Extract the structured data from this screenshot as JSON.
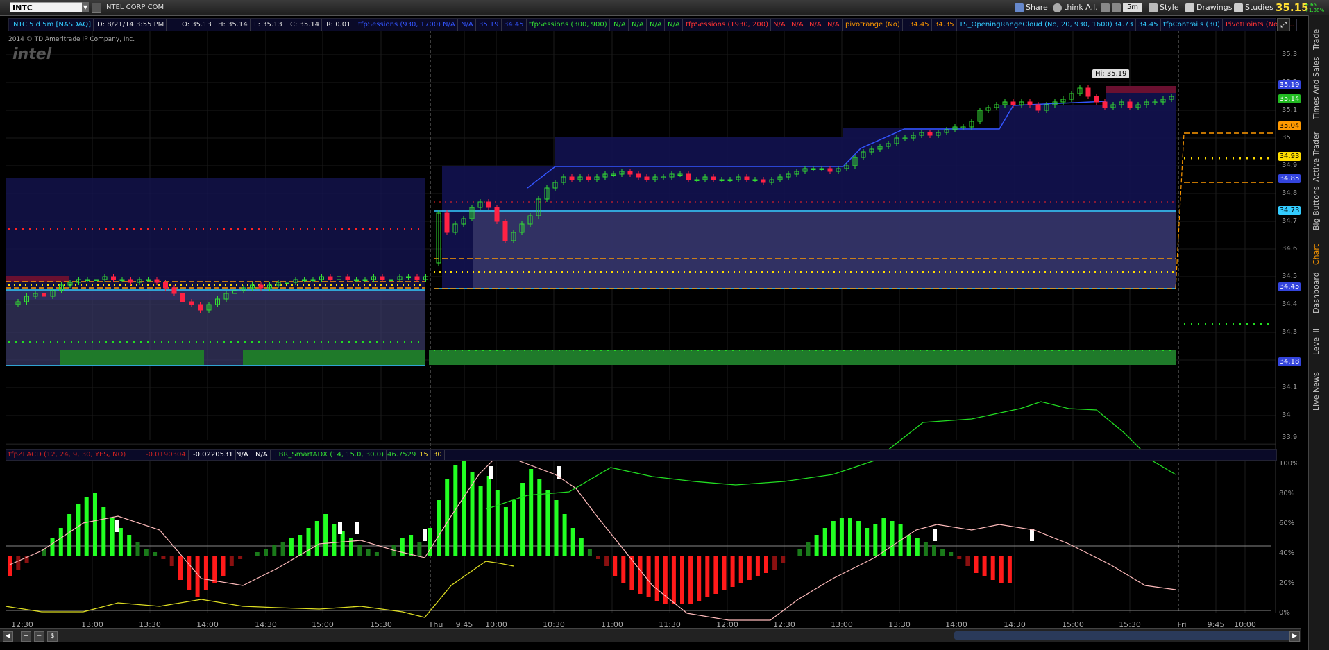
{
  "toolbar": {
    "symbol": "INTC",
    "company": "INTEL CORP COM",
    "share": "Share",
    "think": "think A.I.",
    "timeframe": "5m",
    "style": "Style",
    "drawings": "Drawings",
    "studies": "Studies",
    "last_price": "35.15",
    "change_line1": "+.65",
    "change_line2": "+1.88%"
  },
  "studybar": {
    "items": [
      {
        "text": "INTC 5 d 5m [NASDAQ]",
        "color": "#33ccff"
      },
      {
        "text": "D: 8/21/14 3:55 PM",
        "color": "#dddddd"
      },
      {
        "text": "O: 35.13",
        "color": "#dddddd"
      },
      {
        "text": "H: 35.14",
        "color": "#dddddd"
      },
      {
        "text": "L: 35.13",
        "color": "#dddddd"
      },
      {
        "text": "C: 35.14",
        "color": "#dddddd"
      },
      {
        "text": "R: 0.01",
        "color": "#dddddd"
      },
      {
        "text": "tfpSessions (930, 1700)",
        "color": "#3355ff"
      },
      {
        "text": "N/A",
        "color": "#3355ff"
      },
      {
        "text": "N/A",
        "color": "#3355ff"
      },
      {
        "text": "35.19",
        "color": "#3355ff"
      },
      {
        "text": "34.45",
        "color": "#3355ff"
      },
      {
        "text": "tfpSessions (300, 900)",
        "color": "#33dd33"
      },
      {
        "text": "N/A",
        "color": "#33dd33"
      },
      {
        "text": "N/A",
        "color": "#33dd33"
      },
      {
        "text": "N/A",
        "color": "#33dd33"
      },
      {
        "text": "N/A",
        "color": "#33dd33"
      },
      {
        "text": "tfpSessions (1930, 200)",
        "color": "#ff3333"
      },
      {
        "text": "N/A",
        "color": "#ff3333"
      },
      {
        "text": "N/A",
        "color": "#ff3333"
      },
      {
        "text": "N/A",
        "color": "#ff3333"
      },
      {
        "text": "N/A",
        "color": "#ff3333"
      },
      {
        "text": "pivotrange (No)",
        "color": "#ff9900"
      },
      {
        "text": "34.45",
        "color": "#ff9900"
      },
      {
        "text": "34.35",
        "color": "#ff9900"
      },
      {
        "text": "TS_OpeningRangeCloud (No, 20, 930, 1600)",
        "color": "#33ccff"
      },
      {
        "text": "34.73",
        "color": "#33ccff"
      },
      {
        "text": "34.45",
        "color": "#33ccff"
      },
      {
        "text": "tfpContrails (30)",
        "color": "#33ccff"
      },
      {
        "text": "PivotPoints (No, D...",
        "color": "#ff3333"
      }
    ]
  },
  "copyright": "2014 © TD Ameritrade IP Company, Inc.",
  "logo": "intel",
  "price_axis": {
    "ticks": [
      "35.3",
      "35.2",
      "35.1",
      "35",
      "34.9",
      "34.8",
      "34.7",
      "34.6",
      "34.5",
      "34.4",
      "34.3",
      "34.2",
      "34.1",
      "34",
      "33.9"
    ],
    "tags": [
      {
        "text": "35.19",
        "bg": "#3344dd",
        "fg": "#ffffff"
      },
      {
        "text": "35.14",
        "bg": "#22bb22",
        "fg": "#ffffff"
      },
      {
        "text": "35.04",
        "bg": "#ff9900",
        "fg": "#000000"
      },
      {
        "text": "34.93",
        "bg": "#ffdd00",
        "fg": "#000000"
      },
      {
        "text": "34.85",
        "bg": "#3344dd",
        "fg": "#ffffff"
      },
      {
        "text": "34.73",
        "bg": "#33ccff",
        "fg": "#000000"
      },
      {
        "text": "34.45",
        "bg": "#3344dd",
        "fg": "#ffffff"
      },
      {
        "text": "34.18",
        "bg": "#3344dd",
        "fg": "#ffffff"
      }
    ],
    "hi_label": "Hi: 35.19"
  },
  "lower": {
    "items": [
      {
        "text": "tfpZLACD (12, 24, 9, 30, YES, NO)",
        "color": "#cc2222"
      },
      {
        "text": "-0.0190304",
        "color": "#cc2222"
      },
      {
        "text": "-0.0220531",
        "color": "#ffffff"
      },
      {
        "text": "N/A",
        "color": "#ffffff"
      },
      {
        "text": "N/A",
        "color": "#ffffff"
      },
      {
        "text": "LBR_SmartADX (14, 15.0, 30.0)",
        "color": "#33dd33"
      },
      {
        "text": "46.7529",
        "color": "#33dd33"
      },
      {
        "text": "15",
        "color": "#ffdd33"
      },
      {
        "text": "30",
        "color": "#ffdd33"
      }
    ],
    "ticks": [
      "100%",
      "80%",
      "60%",
      "40%",
      "20%",
      "0%"
    ]
  },
  "time_axis": [
    "12:30",
    "13:00",
    "13:30",
    "14:00",
    "14:30",
    "15:00",
    "15:30",
    "Thu",
    "9:45",
    "10:00",
    "10:30",
    "11:00",
    "11:30",
    "12:00",
    "12:30",
    "13:00",
    "13:30",
    "14:00",
    "14:30",
    "15:00",
    "15:30",
    "Fri",
    "9:45",
    "10:00"
  ],
  "sidebar": {
    "tabs": [
      "Trade",
      "Times And Sales",
      "Active Trader",
      "Big Buttons",
      "Chart",
      "Dashboard",
      "Level II",
      "Live News"
    ],
    "active": "Chart"
  },
  "bottom_buttons": [
    "+",
    "−",
    "$"
  ]
}
